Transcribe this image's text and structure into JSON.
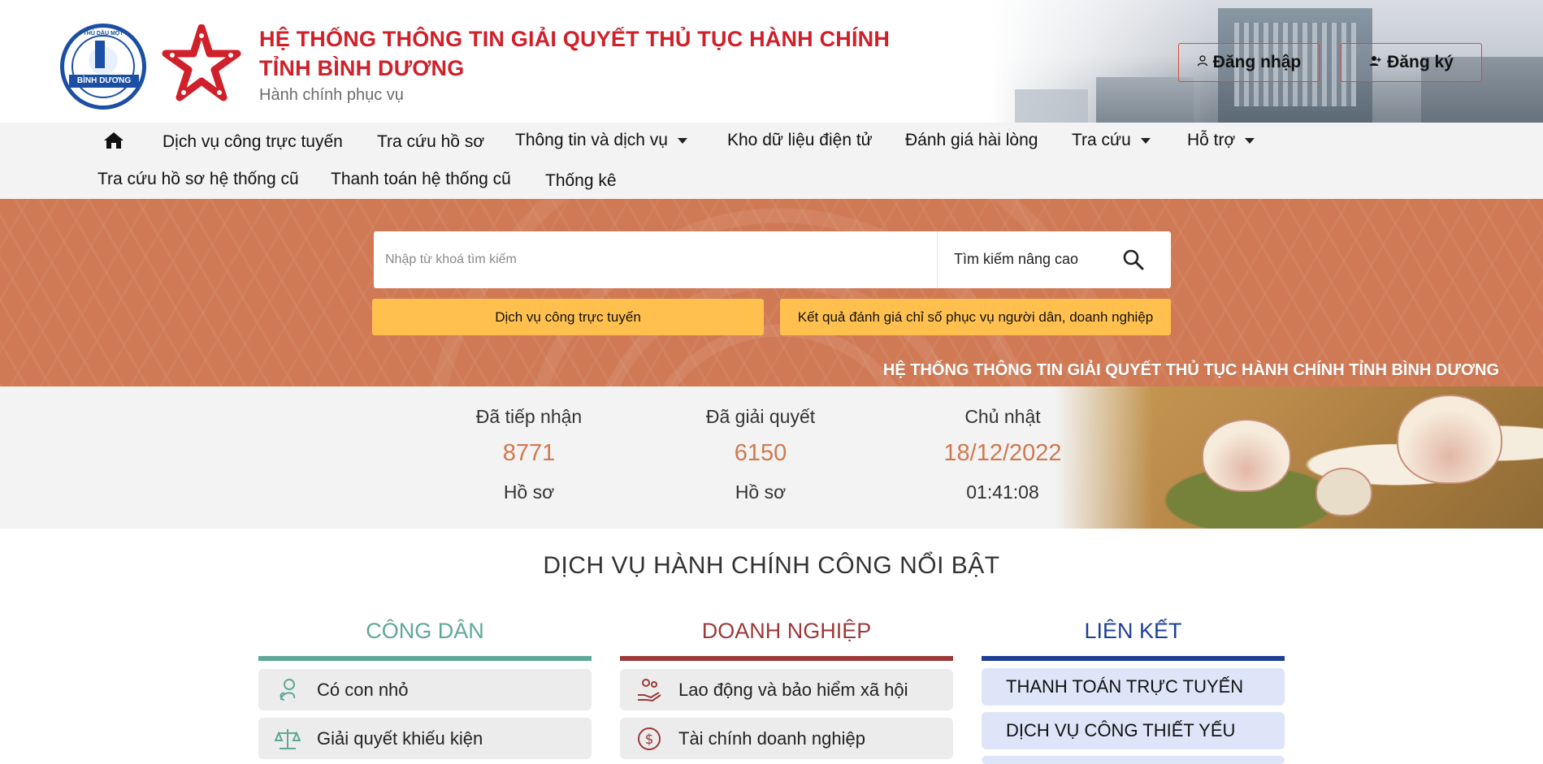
{
  "header": {
    "logo1": {
      "arc_text": "THỦ DẦU MỘT",
      "band_text": "BÌNH DƯƠNG"
    },
    "title_line1": "HỆ THỐNG THÔNG TIN GIẢI QUYẾT THỦ TỤC HÀNH CHÍNH",
    "title_line2": "TỈNH BÌNH DƯƠNG",
    "subtitle": "Hành chính phục vụ",
    "login_label": "Đăng nhập",
    "register_label": "Đăng ký",
    "login_icon": "person-icon",
    "register_icon": "person-add-icon"
  },
  "nav": {
    "row1": [
      {
        "label": "Dịch vụ công trực tuyến",
        "dropdown": false
      },
      {
        "label": "Tra cứu hồ sơ",
        "dropdown": false
      },
      {
        "label": "Thông tin và dịch vụ",
        "dropdown": true
      },
      {
        "label": "Kho dữ liệu điện tử",
        "dropdown": false
      },
      {
        "label": "Đánh giá hài lòng",
        "dropdown": false
      },
      {
        "label": "Tra cứu",
        "dropdown": true
      },
      {
        "label": "Hỗ trợ",
        "dropdown": true
      }
    ],
    "row2": [
      {
        "label": "Tra cứu hồ sơ hệ thống cũ"
      },
      {
        "label": "Thanh toán hệ thống cũ"
      },
      {
        "label": "Thống kê"
      }
    ]
  },
  "search": {
    "placeholder": "Nhập từ khoá tìm kiếm",
    "value": "",
    "advanced_label": "Tìm kiếm nâng cao",
    "online_services_button": "Dịch vụ công trực tuyến",
    "evaluation_button": "Kết quả đánh giá chỉ số phục vụ người dân, doanh nghiệp",
    "caption": "HỆ THỐNG THÔNG TIN GIẢI QUYẾT THỦ TỤC HÀNH CHÍNH TỈNH BÌNH DƯƠNG"
  },
  "stats": {
    "received": {
      "label": "Đã tiếp nhận",
      "value": "8771",
      "unit": "Hồ sơ"
    },
    "resolved": {
      "label": "Đã giải quyết",
      "value": "6150",
      "unit": "Hồ sơ"
    },
    "date": {
      "label": "Chủ nhật",
      "value": "18/12/2022",
      "unit": "01:41:08"
    }
  },
  "featured": {
    "title": "DỊCH VỤ HÀNH CHÍNH CÔNG NỔI BẬT",
    "citizen": {
      "title": "CÔNG DÂN",
      "color": "#5fa898",
      "items": [
        {
          "label": "Có con nhỏ",
          "icon": "baby-icon"
        },
        {
          "label": "Giải quyết khiếu kiện",
          "icon": "scales-icon"
        }
      ]
    },
    "business": {
      "title": "DOANH NGHIỆP",
      "color": "#9c3a3a",
      "items": [
        {
          "label": "Lao động và bảo hiểm xã hội",
          "icon": "hand-care-icon"
        },
        {
          "label": "Tài chính doanh nghiệp",
          "icon": "dollar-coin-icon"
        }
      ]
    },
    "links": {
      "title": "LIÊN KẾT",
      "color": "#1e3f94",
      "items": [
        {
          "label": "THANH TOÁN TRỰC TUYẾN"
        },
        {
          "label": "DỊCH VỤ CÔNG THIẾT YẾU"
        }
      ]
    }
  }
}
